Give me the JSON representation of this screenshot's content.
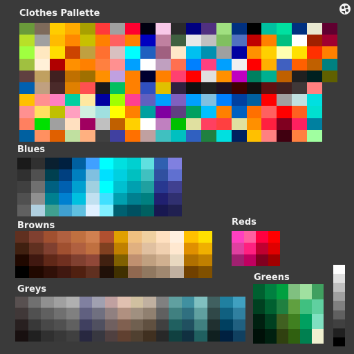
{
  "app": {
    "title": "Clothes Pallette",
    "accent": "#f2f2f2",
    "background": "#3a3a3a",
    "icon": "palette-icon"
  },
  "sections": {
    "clothes": {
      "title": "Clothes Pallette",
      "rows": [
        [
          "#6a9a3a",
          "#7e6a5a",
          "#ffcc00",
          "#ffaa00",
          "#a8a000",
          "#ff3a3a",
          "#a0a0a0",
          "#ff0030",
          "#000010",
          "#f8c8e8",
          "#2a2a2a",
          "#000080",
          "#503080",
          "#a0e080",
          "#003080",
          "#000000",
          "#00c0a0",
          "#00e0a0",
          "#003080",
          "#e8e8d0",
          "#600030"
        ],
        [
          "#b8e028",
          "#a0a0a0",
          "#ffbb00",
          "#ff8800",
          "#c8c000",
          "#ff8000",
          "#ff6060",
          "#ff8000",
          "#0000c0",
          "#c080a0",
          "#406040",
          "#e8e8e8",
          "#c0c0c0",
          "#80c060",
          "#5070c0",
          "#c00000",
          "#ff8000",
          "#00c080",
          "#ffffff",
          "#a02000",
          "#a00030"
        ],
        [
          "#a0ff40",
          "#ffe8c0",
          "#ffdd00",
          "#cc4400",
          "#c0a040",
          "#ff7030",
          "#d8c0c0",
          "#00ffff",
          "#2060c0",
          "#a06080",
          "#ffe8c8",
          "#00c0f0",
          "#0090b0",
          "#a0a0a0",
          "#0000a0",
          "#ff9000",
          "#ffd000",
          "#ffffb0",
          "#ffe000",
          "#ff3000",
          "#ff8000"
        ],
        [
          "#a0c040",
          "#fff0d8",
          "#b00000",
          "#ff9000",
          "#ff8000",
          "#ff8040",
          "#ff9090",
          "#00a0ff",
          "#ffffff",
          "#c0a0c0",
          "#ff7050",
          "#0080ff",
          "#ff4080",
          "#00a0ff",
          "#f0f0f0",
          "#ff0000",
          "#ffb000",
          "#4060c0",
          "#ff6000",
          "#c06000",
          "#008080"
        ],
        [
          "#604040",
          "#c0a060",
          "#402020",
          "#c07000",
          "#a07000",
          "#ff9000",
          "#c0a0e0",
          "#ff8000",
          "#000030",
          "#ff8000",
          "#ff4070",
          "#ff0000",
          "#e0e0e0",
          "#ff9000",
          "#c000c0",
          "#008060",
          "#00b090",
          "#c06000",
          "#202020",
          "#002020",
          "#606000"
        ],
        [
          "#0060b0",
          "#c0a080",
          "#4a2a2a",
          "#e08000",
          "#ff5050",
          "#1a1a1a",
          "#00c060",
          "#ff8000",
          "#3050c0",
          "#e0c000",
          "#302040",
          "#101010",
          "#202020",
          "#201020",
          "#400000",
          "#101010",
          "#601010",
          "#402020",
          "#403838",
          "#ff8080"
        ],
        [
          "#ffc000",
          "#ff9090",
          "#ff80c0",
          "#00d0a0",
          "#ffe8a0",
          "#0000a0",
          "#a0ff00",
          "#ff4090",
          "#6060c0",
          "#00a0ff",
          "#8060c0",
          "#00a0ff",
          "#80c0e0",
          "#0080ff",
          "#0040a0",
          "#0060a0",
          "#ff0000",
          "#a0a0a0",
          "#c0e0e0",
          "#00e0e0"
        ],
        [
          "#ff9090",
          "#ffe060",
          "#c0c000",
          "#ffa0c0",
          "#d0f0e0",
          "#a0e0e0",
          "#ffff00",
          "#ff8000",
          "#00a0a0",
          "#8000a0",
          "#604080",
          "#00a060",
          "#00c0ff",
          "#ff8000",
          "#0060c0",
          "#ff7000",
          "#ff6060",
          "#ff0000",
          "#ff6020",
          "#00e0d0"
        ],
        [
          "#ff8060",
          "#00e000",
          "#a0a0a0",
          "#ffe0c0",
          "#a00060",
          "#c0c0c0",
          "#c06000",
          "#ffd000",
          "#ffffff",
          "#c080c0",
          "#00c000",
          "#e0e0a0",
          "#ff4060",
          "#ff4040",
          "#e0e0a0",
          "#ff9000",
          "#ff2040",
          "#800020",
          "#ff2060",
          "#0080a0"
        ],
        [
          "#0060a0",
          "#ff9060",
          "#e06000",
          "#c0e0a0",
          "#ffb080",
          "#404040",
          "#4040a0",
          "#ff7000",
          "#c0a0a0",
          "#40c0c0",
          "#00c0c0",
          "#3060c0",
          "#208040",
          "#00e0e0",
          "#002060",
          "#ffc000",
          "#ff8080",
          "#400010",
          "#ff8040",
          "#a0ffa0"
        ]
      ]
    },
    "blues": {
      "title": "Blues",
      "rows": [
        [
          "#1a1a1a",
          "#303030",
          "#0a2030",
          "#002040",
          "#0060a0",
          "#40a0ff",
          "#00ffff",
          "#00e0e0",
          "#00d0d0",
          "#60e0e0",
          "#3060b0",
          "#8080e0"
        ],
        [
          "#303030",
          "#505050",
          "#004050",
          "#004080",
          "#0080c0",
          "#80c0e0",
          "#00e0ff",
          "#00d0e0",
          "#00c0c0",
          "#40c0c0",
          "#3050a0",
          "#6070d0"
        ],
        [
          "#404040",
          "#707070",
          "#006080",
          "#0060b0",
          "#00a0d0",
          "#a0d0e0",
          "#00ffff",
          "#00c0d0",
          "#00a0b0",
          "#20a0a0",
          "#283890",
          "#404090"
        ],
        [
          "#505050",
          "#909090",
          "#008090",
          "#0080d0",
          "#00c0e0",
          "#c0e0f0",
          "#40e0ff",
          "#00a0b0",
          "#008090",
          "#008080",
          "#202070",
          "#303070"
        ],
        [
          "#606060",
          "#b0d0e0",
          "#40a090",
          "#40a0d0",
          "#60c0e0",
          "#e0f0ff",
          "#80f0ff",
          "#006070",
          "#005060",
          "#006060",
          "#181850",
          "#202050"
        ]
      ]
    },
    "browns": {
      "title": "Browns",
      "rows": [
        [
          "#603020",
          "#804030",
          "#a05030",
          "#b06040",
          "#c07040",
          "#d08050",
          "#b05030",
          "#e0a000",
          "#f0c080",
          "#f0d0a0",
          "#ffe0c0",
          "#fff0e0",
          "#ffc000",
          "#ffe000"
        ],
        [
          "#402010",
          "#603020",
          "#804030",
          "#a05030",
          "#b06040",
          "#c07040",
          "#804020",
          "#c08000",
          "#e0b080",
          "#e0c0a0",
          "#f0d0b0",
          "#ffe8d0",
          "#e09000",
          "#f0b000"
        ],
        [
          "#200800",
          "#401810",
          "#602818",
          "#703020",
          "#804030",
          "#904838",
          "#402010",
          "#806000",
          "#c09070",
          "#c0a080",
          "#d0b090",
          "#e8d8c0",
          "#b07000",
          "#c08000"
        ],
        [
          "#000000",
          "#200800",
          "#301008",
          "#401810",
          "#502010",
          "#603020",
          "#201008",
          "#403000",
          "#906850",
          "#907860",
          "#a08870",
          "#c0b0a0",
          "#704000",
          "#805000"
        ]
      ]
    },
    "reds": {
      "title": "Reds",
      "rows": [
        [
          "#ff40c0",
          "#ff60a0",
          "#ff0040",
          "#ff0000"
        ],
        [
          "#e040a0",
          "#ff2080",
          "#c00030",
          "#e00000"
        ],
        [
          "#a02070",
          "#c00060",
          "#800020",
          "#a00000"
        ]
      ]
    },
    "greys": {
      "title": "Greys",
      "rows": [
        [
          "#585050",
          "#707070",
          "#909090",
          "#a0a0a0",
          "#b0b0b0",
          "#8080a0",
          "#a0a0b0",
          "#c0a0a0",
          "#e0c0b0",
          "#d0c0a0",
          "#c0b0a0",
          "#808080",
          "#60a0a0",
          "#4090a0",
          "#80c0c0",
          "#406060",
          "#2080a0",
          "#40a0c0"
        ],
        [
          "#403838",
          "#505050",
          "#606060",
          "#707070",
          "#808080",
          "#606080",
          "#707080",
          "#908080",
          "#b09080",
          "#a09080",
          "#908070",
          "#606060",
          "#408080",
          "#307080",
          "#60a0a0",
          "#304848",
          "#106080",
          "#3080a0"
        ],
        [
          "#282020",
          "#383838",
          "#484848",
          "#505050",
          "#606060",
          "#404060",
          "#505060",
          "#706060",
          "#806050",
          "#706050",
          "#605040",
          "#404040",
          "#206060",
          "#205060",
          "#408080",
          "#203030",
          "#004060",
          "#206080"
        ],
        [
          "#181010",
          "#202020",
          "#303030",
          "#383838",
          "#404040",
          "#282840",
          "#383840",
          "#504040",
          "#604030",
          "#504030",
          "#403020",
          "#282828",
          "#104040",
          "#103040",
          "#206060",
          "#102020",
          "#002040",
          "#104060"
        ]
      ]
    },
    "greens": {
      "title": "Greens",
      "rows": [
        [
          "#006030",
          "#008040",
          "#00a040",
          "#80c080",
          "#a0e0a0",
          "#40a060"
        ],
        [
          "#004020",
          "#006030",
          "#208040",
          "#60a040",
          "#40c080",
          "#60d0a0"
        ],
        [
          "#002010",
          "#004020",
          "#406020",
          "#408020",
          "#00a060",
          "#80e0c0"
        ],
        [
          "#001008",
          "#002010",
          "#304010",
          "#306010",
          "#008050",
          "#f0f0d0"
        ]
      ]
    },
    "whites": {
      "rows": [
        "#ffffff",
        "#e0e0e0",
        "#c0c0c0",
        "#a0a0a0",
        "#808080",
        "#606060",
        "#404040",
        "#202020",
        "#000000"
      ]
    }
  }
}
